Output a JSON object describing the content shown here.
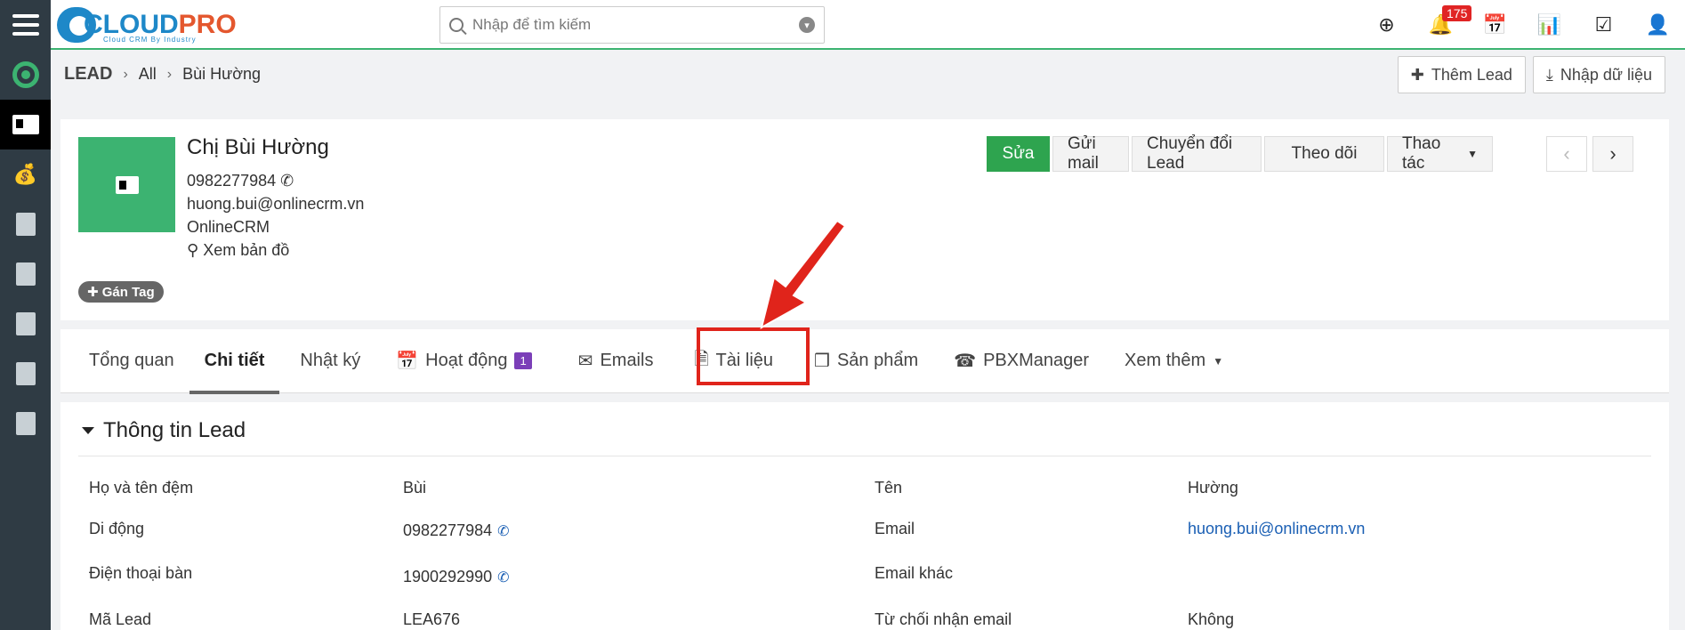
{
  "brand": {
    "name_part1": "CLOUD",
    "name_part2": "PRO",
    "tagline": "Cloud CRM By Industry"
  },
  "search": {
    "placeholder": "Nhập để tìm kiếm"
  },
  "notifications": {
    "count": "175"
  },
  "breadcrumb": {
    "module": "LEAD",
    "list": "All",
    "record": "Bùi Hường"
  },
  "top_actions": {
    "add_lead": "Thêm Lead",
    "import": "Nhập dữ liệu"
  },
  "profile": {
    "name": "Chị Bùi Hường",
    "phone": "0982277984",
    "email": "huong.bui@onlinecrm.vn",
    "company": "OnlineCRM",
    "map_link": "Xem bản đồ",
    "tag_button": "Gán Tag"
  },
  "record_actions": {
    "edit": "Sửa",
    "send_mail": "Gửi mail",
    "convert": "Chuyển đổi Lead",
    "follow": "Theo dõi",
    "more": "Thao tác"
  },
  "tabs": [
    {
      "label": "Tổng quan"
    },
    {
      "label": "Chi tiết"
    },
    {
      "label": "Nhật ký"
    },
    {
      "label": "Hoạt động",
      "count": "1"
    },
    {
      "label": "Emails"
    },
    {
      "label": "Tài liệu"
    },
    {
      "label": "Sản phẩm"
    },
    {
      "label": "PBXManager"
    },
    {
      "label": "Xem thêm"
    }
  ],
  "section": {
    "title": "Thông tin Lead",
    "fields": [
      {
        "label": "Họ và tên đệm",
        "value": "Bùi",
        "label2": "Tên",
        "value2": "Hường"
      },
      {
        "label": "Di động",
        "value": "0982277984",
        "label2": "Email",
        "value2": "huong.bui@onlinecrm.vn"
      },
      {
        "label": "Điện thoại bàn",
        "value": "1900292990",
        "label2": "Email khác",
        "value2": ""
      },
      {
        "label": "Mã Lead",
        "value": "LEA676",
        "label2": "Từ chối nhận email",
        "value2": "Không"
      }
    ]
  },
  "colors": {
    "accent_green": "#3cb371",
    "highlight_red": "#e0241b",
    "sidebar": "#2f3b44"
  }
}
